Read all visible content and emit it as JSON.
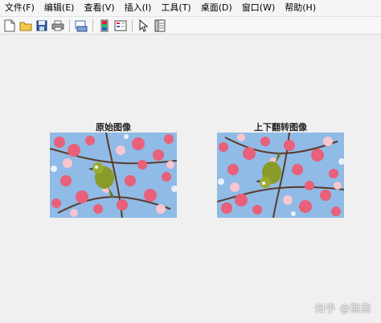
{
  "menu": [
    "文件(F)",
    "编辑(E)",
    "查看(V)",
    "插入(I)",
    "工具(T)",
    "桌面(D)",
    "窗口(W)",
    "帮助(H)"
  ],
  "toolbar": {
    "icons": [
      "new-file-icon",
      "open-folder-icon",
      "save-icon",
      "print-icon",
      "print-figure-icon",
      "colorbar-icon",
      "legend-icon",
      "select-pointer-icon",
      "property-editor-icon"
    ]
  },
  "figure": {
    "left_title": "原始图像",
    "right_title": "上下翻转图像"
  },
  "watermark": "知乎 @熊熊",
  "colors": {
    "sky": "#8fbbe6",
    "blossom_pink": "#e8607a",
    "blossom_light": "#f7c6d0",
    "bird_green": "#8a9a2a"
  }
}
